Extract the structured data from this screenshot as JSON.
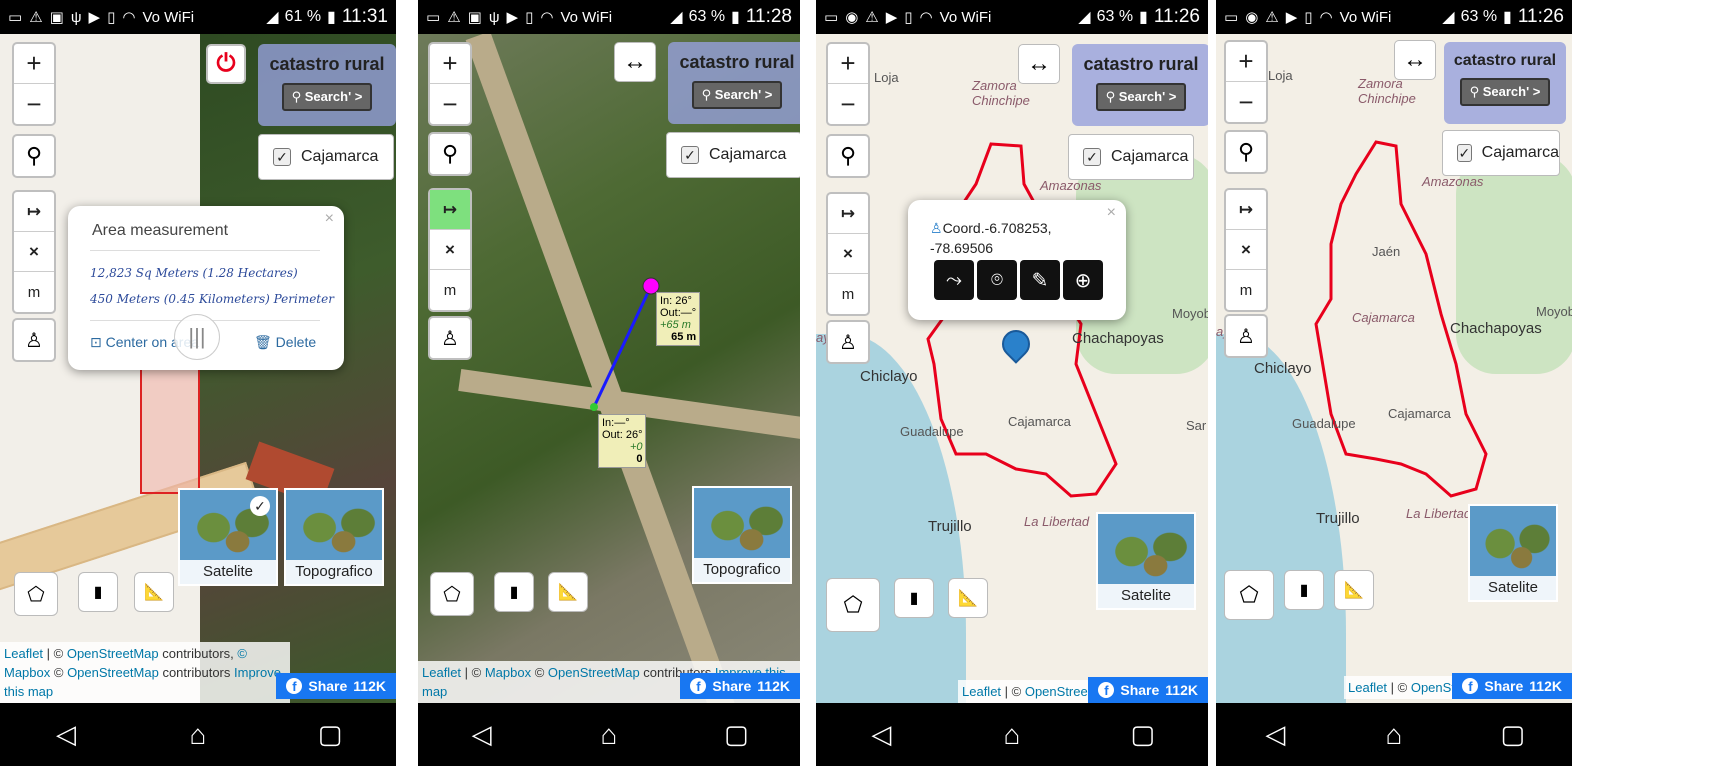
{
  "screens": [
    {
      "status": {
        "battery": "61 %",
        "time": "11:31"
      },
      "catastro": {
        "title": "catastro rural",
        "search": "Search' >"
      },
      "checkbox": {
        "label": "Cajamarca"
      },
      "zoom": {
        "in": "+",
        "out": "−"
      },
      "measure": {
        "start": "↦",
        "clear": "×",
        "unit": "m"
      },
      "popup": {
        "title": "Area measurement",
        "area": "12,823 Sq Meters (1.28 Hectares)",
        "perimeter": "450 Meters (0.45 Kilometers) Perimeter",
        "center": "Center on area",
        "delete": "Delete"
      },
      "layers": [
        {
          "label": "Satelite"
        },
        {
          "label": "Topografico"
        }
      ],
      "attribution": {
        "leaflet": "Leaflet",
        "c1": " | © ",
        "osm": "OpenStreetMap",
        "contrib": " contributors, ",
        "mapbox": "© Mapbox",
        "c2": " © ",
        "osm2": "OpenStreetMap",
        "contrib2": " contributors ",
        "improve": "Improve this map"
      },
      "share": {
        "label": "Share",
        "count": "112K"
      }
    },
    {
      "status": {
        "battery": "63 %",
        "time": "11:28"
      },
      "catastro": {
        "title": "catastro rural",
        "search": "Search' >"
      },
      "checkbox": {
        "label": "Cajamarca"
      },
      "zoom": {
        "in": "+",
        "out": "−"
      },
      "measure": {
        "start": "↦",
        "clear": "×",
        "unit": "m"
      },
      "line_labels": [
        {
          "in": "In: 26°",
          "out": "Out:—°",
          "delta": "+65 m",
          "total": "65 m"
        },
        {
          "in": "In:—°",
          "out": "Out: 26°",
          "delta": "+0",
          "total": "0"
        }
      ],
      "layers": [
        {
          "label": "Topografico"
        }
      ],
      "attribution": {
        "leaflet": "Leaflet",
        "c1": " | © ",
        "mapbox": "Mapbox",
        "c2": " © ",
        "osm": "OpenStreetMap",
        "contrib": " contributors ",
        "improve": "Improve this map"
      },
      "share": {
        "label": "Share",
        "count": "112K"
      }
    },
    {
      "status": {
        "battery": "63 %",
        "time": "11:26"
      },
      "catastro": {
        "title": "catastro rural",
        "search": "Search' >"
      },
      "checkbox": {
        "label": "Cajamarca"
      },
      "zoom": {
        "in": "+",
        "out": "−"
      },
      "measure": {
        "start": "↦",
        "clear": "×",
        "unit": "m"
      },
      "popup": {
        "coord": "Coord.-6.708253, -78.69506"
      },
      "places": [
        "Loja",
        "Zamora Chinchipe",
        "Amazonas",
        "Chachapoyas",
        "Chiclayo",
        "Cajamarca",
        "Guadalupe",
        "Trujillo",
        "La Libertad",
        "Moyob",
        "Sar",
        "ayeque"
      ],
      "layers": [
        {
          "label": "Satelite"
        }
      ],
      "attribution": {
        "leaflet": "Leaflet",
        "c1": " | © ",
        "osm": "OpenStree"
      },
      "share": {
        "label": "Share",
        "count": "112K"
      }
    },
    {
      "status": {
        "battery": "63 %",
        "time": "11:26"
      },
      "catastro": {
        "title": "catastro rural",
        "search": "Search' >"
      },
      "checkbox": {
        "label": "Cajamarca"
      },
      "zoom": {
        "in": "+",
        "out": "−"
      },
      "measure": {
        "start": "↦",
        "clear": "×",
        "unit": "m"
      },
      "places": [
        "Loja",
        "Zamora Chinchipe",
        "Amazonas",
        "Jaén",
        "Cajamarca",
        "Chachapoyas",
        "Chiclayo",
        "Guadalupe",
        "Cajamarca",
        "Trujillo",
        "La Libertad",
        "Moyob",
        "ayeque"
      ],
      "layers": [
        {
          "label": "Satelite"
        }
      ],
      "attribution": {
        "leaflet": "Leaflet",
        "c1": " | © ",
        "osm": "OpenStree"
      },
      "share": {
        "label": "Share",
        "count": "112K"
      }
    }
  ],
  "status_common": {
    "volte": "Vo WiFi"
  },
  "colors": {
    "accent_red": "#e8001c",
    "catastro_bg": "#96a0dc",
    "share_blue": "#1877f2",
    "marker_blue": "#2a81cb",
    "measure_green": "#7ee07e"
  }
}
